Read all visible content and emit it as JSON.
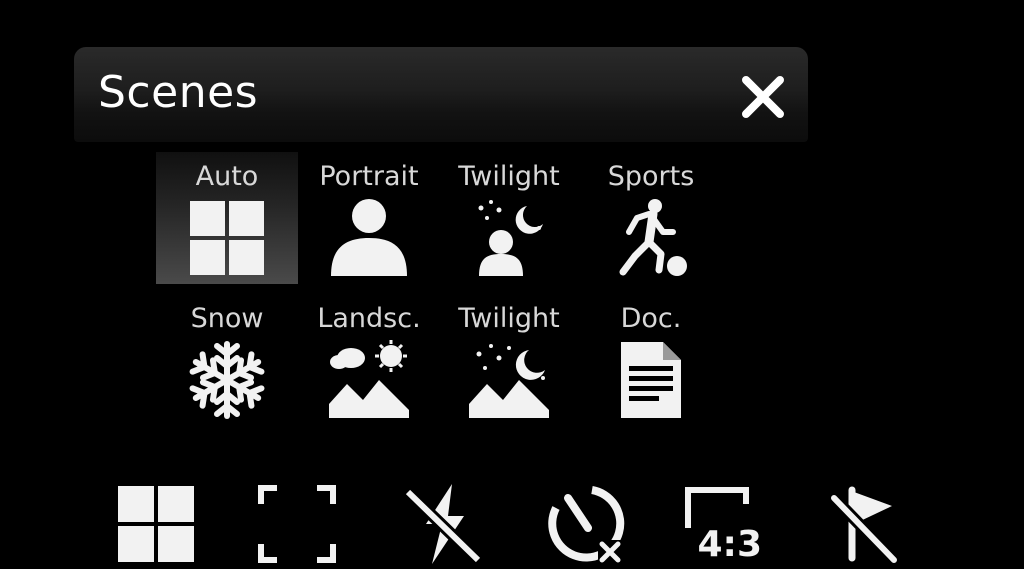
{
  "header": {
    "title": "Scenes",
    "close_icon": "close-icon"
  },
  "scenes": [
    {
      "label": "Auto",
      "icon": "auto-grid-icon",
      "selected": true
    },
    {
      "label": "Portrait",
      "icon": "portrait-icon",
      "selected": false
    },
    {
      "label": "Twilight",
      "icon": "twilight-portrait-icon",
      "selected": false
    },
    {
      "label": "Sports",
      "icon": "sports-icon",
      "selected": false
    },
    {
      "label": "Snow",
      "icon": "snowflake-icon",
      "selected": false
    },
    {
      "label": "Landsc.",
      "icon": "landscape-icon",
      "selected": false
    },
    {
      "label": "Twilight",
      "icon": "twilight-landscape-icon",
      "selected": false
    },
    {
      "label": "Doc.",
      "icon": "document-icon",
      "selected": false
    }
  ],
  "toolbar": {
    "items": [
      {
        "icon": "scene-grid-icon"
      },
      {
        "icon": "focus-frame-icon"
      },
      {
        "icon": "flash-off-icon"
      },
      {
        "icon": "self-timer-off-icon"
      },
      {
        "icon": "aspect-ratio-icon",
        "text": "4:3"
      },
      {
        "icon": "geotag-off-icon"
      }
    ]
  },
  "colors": {
    "background": "#000000",
    "foreground": "#f2f2f2",
    "label": "#d8d8d8"
  }
}
